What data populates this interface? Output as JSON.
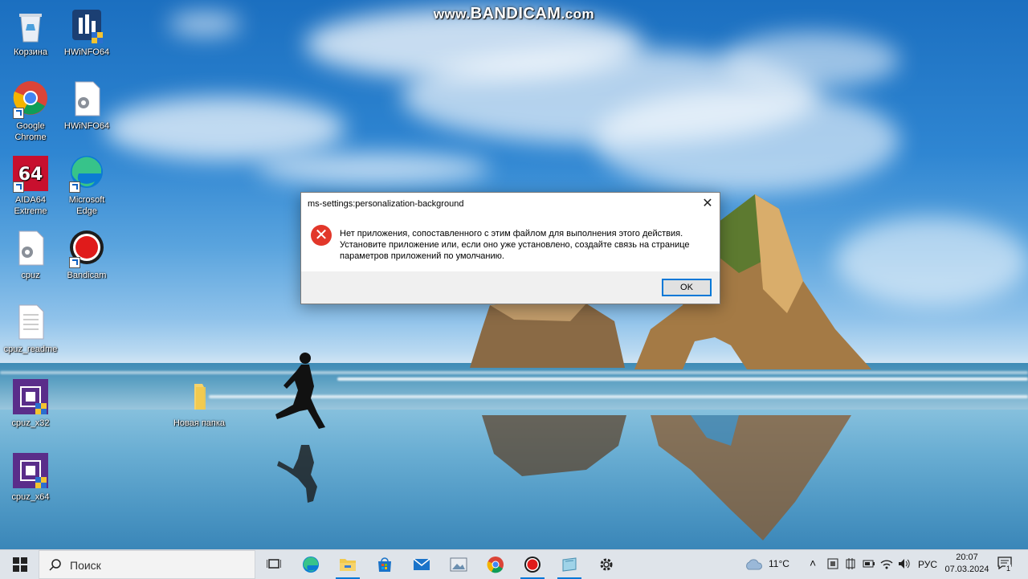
{
  "watermark": {
    "prefix": "www.",
    "brand": "BANDICAM",
    "suffix": ".com"
  },
  "desktop_icons": [
    {
      "label": "Корзина",
      "icon": "recycle-bin-icon"
    },
    {
      "label": "HWiNFO64",
      "icon": "hwinfo-icon"
    },
    {
      "label": "Google Chrome",
      "icon": "chrome-icon"
    },
    {
      "label": "HWiNFO64",
      "icon": "config-file-icon"
    },
    {
      "label": "AIDA64 Extreme",
      "icon": "aida64-icon"
    },
    {
      "label": "Microsoft Edge",
      "icon": "edge-icon"
    },
    {
      "label": "cpuz",
      "icon": "config-file-icon"
    },
    {
      "label": "Bandicam",
      "icon": "bandicam-icon"
    },
    {
      "label": "cpuz_readme",
      "icon": "text-file-icon"
    },
    {
      "label": "cpuz_x32",
      "icon": "cpuz-icon"
    },
    {
      "label": "Новая папка",
      "icon": "folder-icon"
    },
    {
      "label": "cpuz_x64",
      "icon": "cpuz-icon"
    }
  ],
  "dialog": {
    "title": "ms-settings:personalization-background",
    "close_label": "✕",
    "message_line1": "Нет приложения, сопоставленного с этим файлом для выполнения этого действия.",
    "message_line2": "Установите приложение или, если оно уже установлено, создайте связь на странице",
    "message_line3": "параметров приложений по умолчанию.",
    "ok_label": "OK"
  },
  "taskbar": {
    "search_placeholder": "Поиск",
    "pinned": [
      "task-view-icon",
      "edge-icon",
      "file-explorer-icon",
      "store-icon",
      "mail-icon",
      "photos-icon",
      "chrome-icon",
      "bandicam-icon",
      "notes-icon",
      "settings-icon"
    ],
    "weather": "11°C",
    "language": "РУС",
    "time": "20:07",
    "date": "07.03.2024",
    "notifications": "1"
  }
}
